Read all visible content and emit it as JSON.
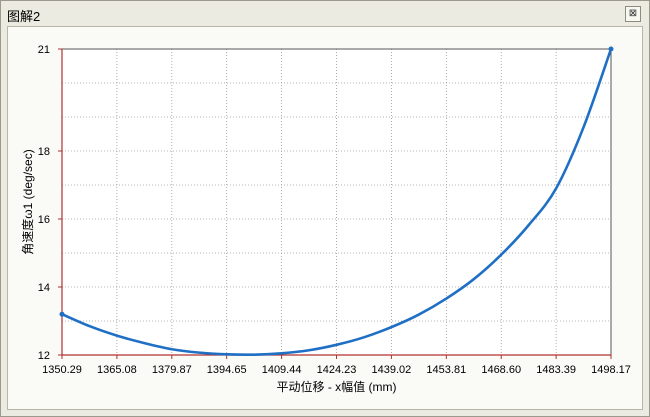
{
  "window": {
    "title": "图解2",
    "close_glyph": "⊠"
  },
  "chart_data": {
    "type": "line",
    "title": "",
    "xlabel": "平动位移 - x幅值 (mm)",
    "ylabel": "角速度ω1 (deg/sec)",
    "xlim": [
      1350.29,
      1498.17
    ],
    "ylim": [
      12,
      21
    ],
    "x_ticks": [
      "1350.29",
      "1365.08",
      "1379.87",
      "1394.65",
      "1409.44",
      "1424.23",
      "1439.02",
      "1453.81",
      "1468.60",
      "1483.39",
      "1498.17"
    ],
    "y_ticks": [
      "12",
      "14",
      "16",
      "18",
      "21"
    ],
    "y_tick_values": [
      12,
      14,
      16,
      18,
      21
    ],
    "grid": true,
    "colors": {
      "series": "#1f6fc5",
      "axis": "#b0312f",
      "grid": "#9a9a9a"
    },
    "series": [
      {
        "x": [
          1350.29,
          1357.68,
          1365.08,
          1372.47,
          1379.87,
          1387.26,
          1394.65,
          1402.05,
          1409.44,
          1416.84,
          1424.23,
          1431.62,
          1439.02,
          1446.41,
          1453.81,
          1461.2,
          1468.6,
          1475.99,
          1483.39,
          1490.78,
          1498.17
        ],
        "values": [
          13.2,
          12.85,
          12.57,
          12.35,
          12.17,
          12.07,
          12.02,
          12.01,
          12.05,
          12.14,
          12.3,
          12.52,
          12.82,
          13.19,
          13.66,
          14.23,
          14.95,
          15.82,
          16.9,
          18.7,
          21.0
        ]
      }
    ]
  }
}
